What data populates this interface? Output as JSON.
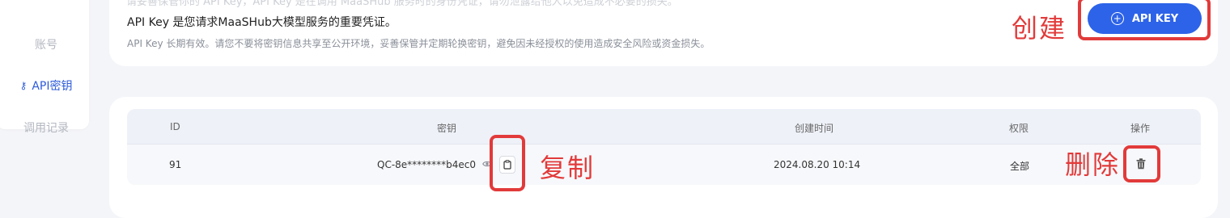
{
  "sidebar": {
    "items": [
      {
        "label": "账号",
        "active": false
      },
      {
        "label": "API密钥",
        "active": true,
        "icon": "key-icon"
      },
      {
        "label": "调用记录",
        "active": false
      }
    ]
  },
  "info": {
    "partial_line": "请妥善保管你的 API Key，API Key 是在调用 MaaSHub 服务时的身份凭证，请勿泄露给他人以免造成不必要的损失。",
    "title": "API Key 是您请求MaaSHub大模型服务的重要凭证。",
    "subtitle": "API Key 长期有效。请您不要将密钥信息共享至公开环境，妥善保管并定期轮换密钥，避免因未经授权的使用造成安全风险或资金损失。"
  },
  "create_button": {
    "label": "API KEY",
    "icon": "plus-circle-icon"
  },
  "annotations": {
    "create": "创建",
    "copy": "复制",
    "delete": "删除",
    "color": "#e23a3a"
  },
  "table": {
    "headers": {
      "id": "ID",
      "key": "密钥",
      "created": "创建时间",
      "permission": "权限",
      "actions": "操作"
    },
    "rows": [
      {
        "id": "91",
        "key": "QC-8e********b4ec0",
        "created": "2024.08.20 10:14",
        "permission": "全部"
      }
    ]
  },
  "colors": {
    "accent": "#2d63e8",
    "active_nav": "#2d5bd8",
    "page_bg": "#f4f5f9"
  }
}
